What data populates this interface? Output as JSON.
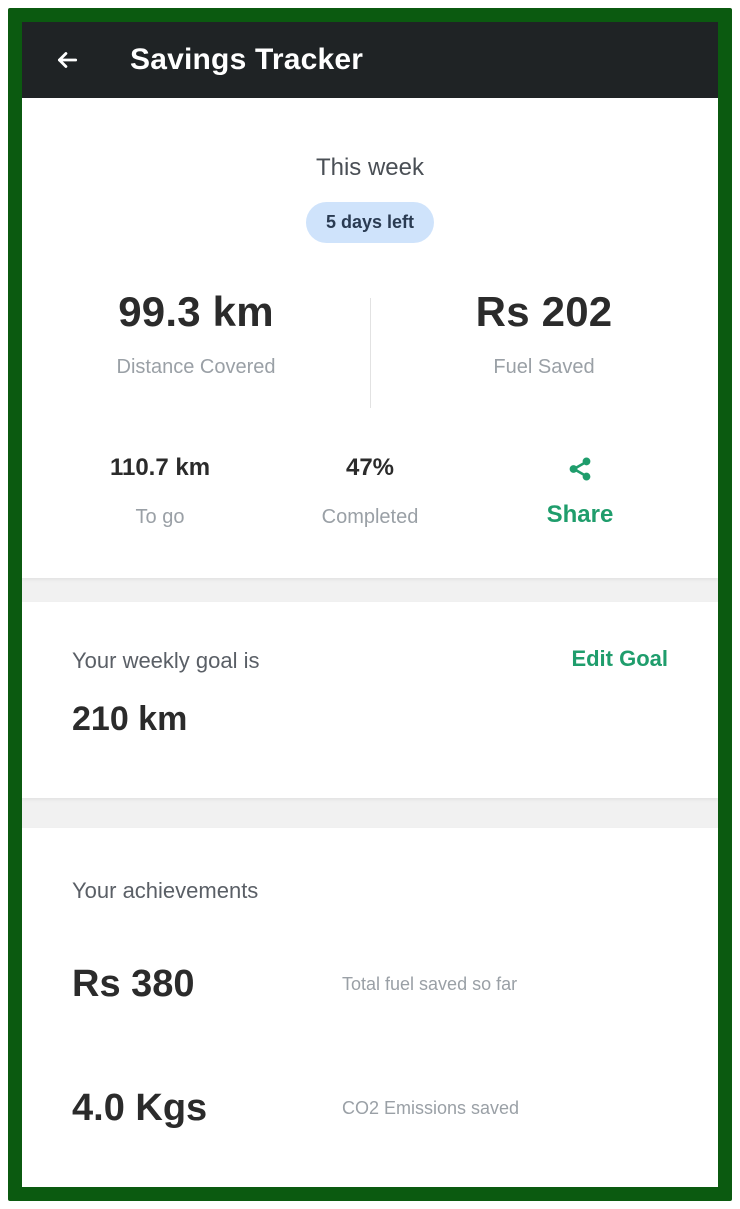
{
  "app": {
    "title": "Savings Tracker"
  },
  "week": {
    "title": "This week",
    "days_left": "5 days left",
    "distance_value": "99.3 km",
    "distance_label": "Distance Covered",
    "fuel_value": "Rs 202",
    "fuel_label": "Fuel Saved",
    "to_go_value": "110.7 km",
    "to_go_label": "To go",
    "completed_value": "47%",
    "completed_label": "Completed",
    "share_label": "Share"
  },
  "goal": {
    "label": "Your weekly goal is",
    "edit_label": "Edit Goal",
    "value": "210 km"
  },
  "achievements": {
    "title": "Your achievements",
    "items": [
      {
        "value": "Rs 380",
        "desc": "Total fuel saved so far"
      },
      {
        "value": "4.0 Kgs",
        "desc": "CO2 Emissions saved"
      }
    ]
  },
  "colors": {
    "frame_green": "#0b5a10",
    "appbar": "#1f2325",
    "accent_green": "#1f9d6c",
    "pill_blue": "#cfe3fb"
  },
  "icons": {
    "back": "back-arrow-icon",
    "share": "share-icon"
  }
}
